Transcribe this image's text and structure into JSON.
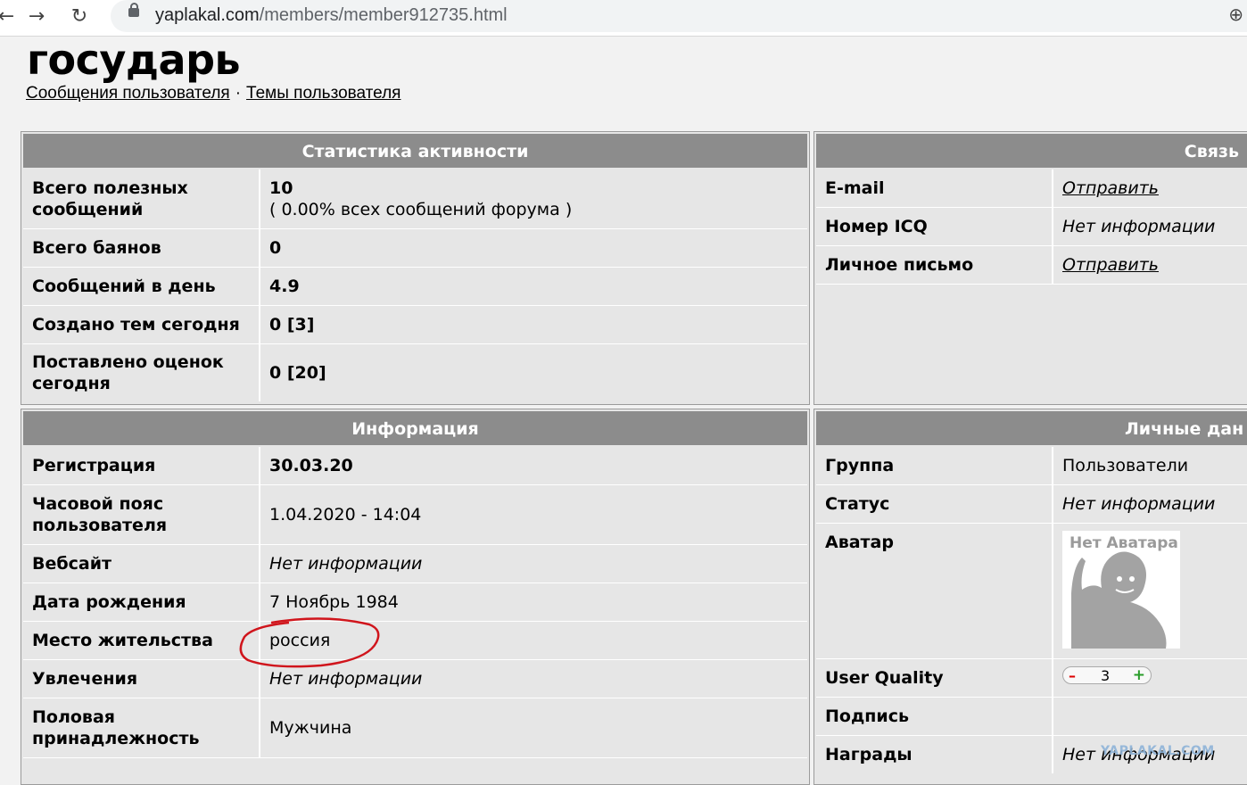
{
  "browser": {
    "url_host": "yaplakal.com",
    "url_path": "/members/member912735.html"
  },
  "profile": {
    "username": "государь",
    "links": {
      "posts": "Сообщения пользователя",
      "separator": "·",
      "topics": "Темы пользователя"
    }
  },
  "stats": {
    "header": "Статистика активности",
    "rows": [
      {
        "label": "Всего полезных сообщений",
        "value": "10",
        "sub": "( 0.00% всех сообщений форума )"
      },
      {
        "label": "Всего баянов",
        "value": "0"
      },
      {
        "label": "Сообщений в день",
        "value": "4.9"
      },
      {
        "label": "Создано тем сегодня",
        "value": "0 [3]"
      },
      {
        "label": "Поставлено оценок сегодня",
        "value": "0 [20]"
      }
    ]
  },
  "contact": {
    "header": "Связь",
    "rows": [
      {
        "label": "E-mail",
        "value": "Отправить"
      },
      {
        "label": "Номер ICQ",
        "value": "Нет информации"
      },
      {
        "label": "Личное письмо",
        "value": "Отправить"
      }
    ]
  },
  "info": {
    "header": "Информация",
    "rows": [
      {
        "label": "Регистрация",
        "value": "30.03.20"
      },
      {
        "label": "Часовой пояс пользователя",
        "value": "1.04.2020 - 14:04"
      },
      {
        "label": "Вебсайт",
        "value": "Нет информации"
      },
      {
        "label": "Дата рождения",
        "value": "7 Ноябрь 1984"
      },
      {
        "label": "Место жительства",
        "value": "россия"
      },
      {
        "label": "Увлечения",
        "value": "Нет информации"
      },
      {
        "label": "Половая принадлежность",
        "value": "Мужчина"
      }
    ]
  },
  "personal": {
    "header": "Личные дан",
    "rows": [
      {
        "label": "Группа",
        "value": "Пользователи"
      },
      {
        "label": "Статус",
        "value": "Нет информации"
      },
      {
        "label": "Аватар",
        "value": "Нет Аватара"
      },
      {
        "label": "User Quality",
        "value": "3",
        "minus": "–",
        "plus": "+"
      },
      {
        "label": "Подпись",
        "value": ""
      },
      {
        "label": "Награды",
        "value": "Нет информации"
      }
    ]
  },
  "watermark": "YAPLAKAL.COM",
  "colors": {
    "header_bg": "#8c8c8c",
    "panel_bg": "#e6e6e6",
    "annotation_circle": "#d0151c"
  }
}
